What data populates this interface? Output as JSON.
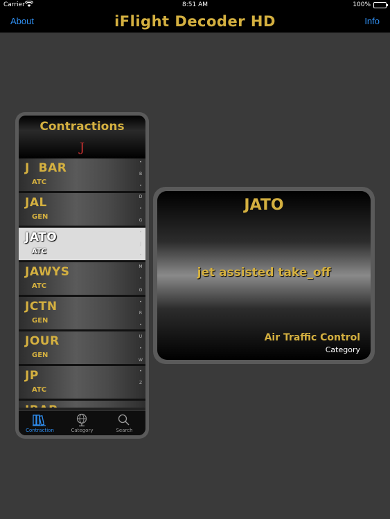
{
  "status_bar": {
    "carrier": "Carrier",
    "time": "8:51 AM",
    "battery": "100%",
    "battery_level": 1.0
  },
  "nav": {
    "left_button": "About",
    "title": "iFlight Decoder HD",
    "right_button": "Info"
  },
  "list_panel": {
    "title": "Contractions",
    "current_letter": "J",
    "rows": [
      {
        "code": "J  BAR",
        "category": "ATC",
        "selected": false
      },
      {
        "code": "JAL",
        "category": "GEN",
        "selected": false
      },
      {
        "code": "JATO",
        "category": "ATC",
        "selected": true
      },
      {
        "code": "JAWYS",
        "category": "ATC",
        "selected": false
      },
      {
        "code": "JCTN",
        "category": "GEN",
        "selected": false
      },
      {
        "code": "JOUR",
        "category": "GEN",
        "selected": false
      },
      {
        "code": "JP",
        "category": "ATC",
        "selected": false
      },
      {
        "code": "JRAP",
        "category": "",
        "selected": false
      }
    ],
    "index_letters": [
      "•",
      "B",
      "•",
      "D",
      "•",
      "G",
      "•",
      "J",
      "•",
      "M",
      "•",
      "O",
      "•",
      "R",
      "•",
      "U",
      "•",
      "W",
      "•",
      "Z"
    ]
  },
  "tabs": [
    {
      "label": "Contraction",
      "icon": "books-icon",
      "active": true
    },
    {
      "label": "Category",
      "icon": "globe-icon",
      "active": false
    },
    {
      "label": "Search",
      "icon": "search-icon",
      "active": false
    }
  ],
  "detail": {
    "code": "JATO",
    "meaning": "jet assisted take_off",
    "category": "Air Traffic Control",
    "category_label": "Category"
  },
  "colors": {
    "accent_gold": "#d4b040",
    "link_blue": "#2f8ef0",
    "letter_red": "#c83030",
    "background": "#3a3a3a"
  }
}
